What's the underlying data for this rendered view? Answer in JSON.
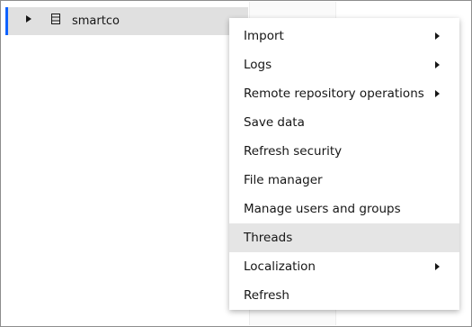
{
  "tree": {
    "selected_item": {
      "label": "smartco",
      "icon": "database-icon"
    }
  },
  "context_menu": {
    "items": [
      {
        "label": "Import",
        "has_submenu": true
      },
      {
        "label": "Logs",
        "has_submenu": true
      },
      {
        "label": "Remote repository operations",
        "has_submenu": true
      },
      {
        "label": "Save data",
        "has_submenu": false
      },
      {
        "label": "Refresh security",
        "has_submenu": false
      },
      {
        "label": "File manager",
        "has_submenu": false
      },
      {
        "label": "Manage users and groups",
        "has_submenu": false
      },
      {
        "label": "Threads",
        "has_submenu": false,
        "hovered": true
      },
      {
        "label": "Localization",
        "has_submenu": true
      },
      {
        "label": "Refresh",
        "has_submenu": false
      }
    ]
  },
  "colors": {
    "selection_accent": "#0f62fe",
    "selected_row_bg": "#e0e0e0",
    "hover_bg": "#e5e5e5"
  }
}
